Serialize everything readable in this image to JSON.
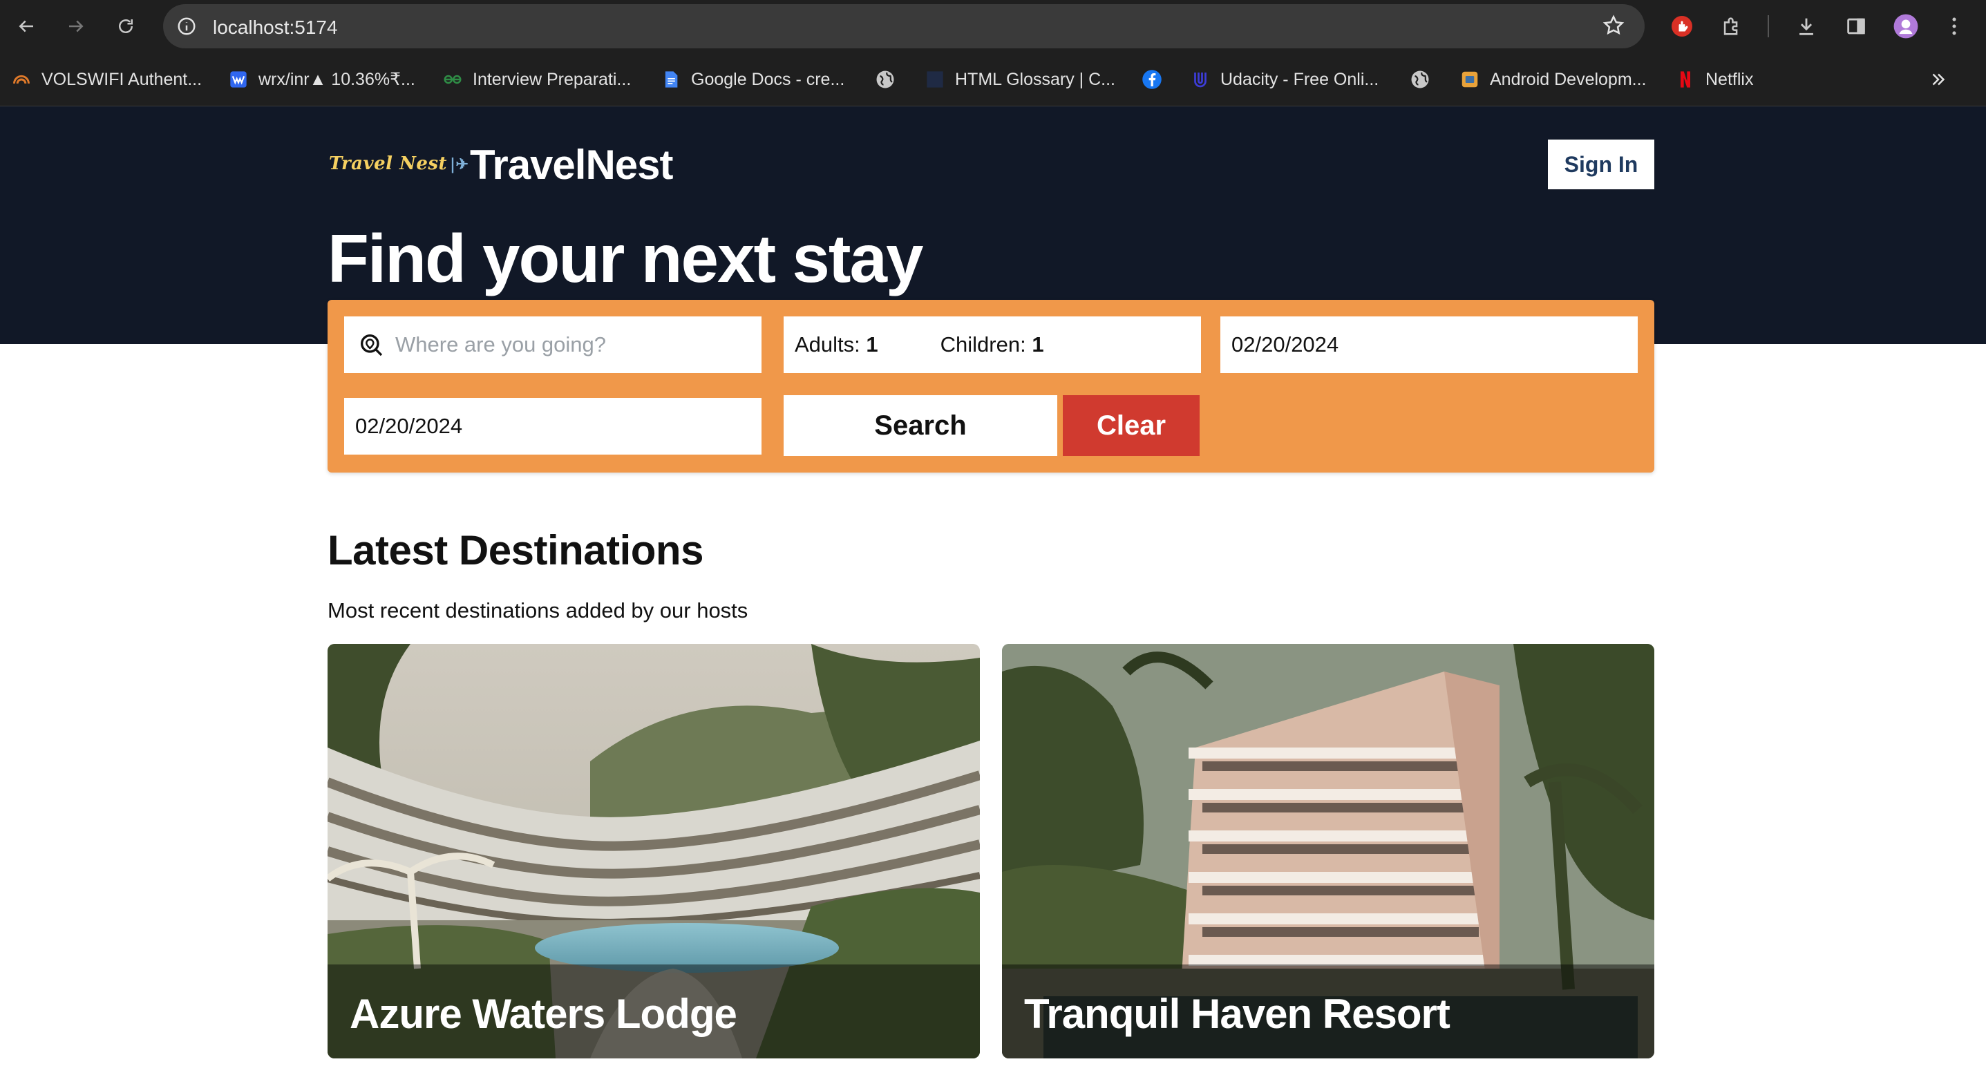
{
  "browser": {
    "url": "localhost:5174",
    "bookmarks": [
      {
        "label": "VOLSWIFI Authent...",
        "icon": "volswifi-icon"
      },
      {
        "label": "wrx/inr▲ 10.36%₹...",
        "icon": "wazirx-icon"
      },
      {
        "label": "Interview Preparati...",
        "icon": "gfg-icon"
      },
      {
        "label": "Google Docs - cre...",
        "icon": "google-docs-icon"
      },
      {
        "label": "",
        "icon": "globe-icon"
      },
      {
        "label": "HTML Glossary | C...",
        "icon": "codecademy-icon"
      },
      {
        "label": "",
        "icon": "facebook-icon"
      },
      {
        "label": "Udacity - Free Onli...",
        "icon": "udacity-icon"
      },
      {
        "label": "",
        "icon": "globe-icon"
      },
      {
        "label": "Android Developm...",
        "icon": "android-icon"
      },
      {
        "label": "Netflix",
        "icon": "netflix-icon"
      }
    ],
    "colors": {
      "frame": "#1f1f1f",
      "omnibox": "#3a3a3a"
    }
  },
  "header": {
    "logo_text": "Travel Nest",
    "brand": "TravelNest",
    "sign_in_label": "Sign In"
  },
  "hero": {
    "title": "Find your next stay"
  },
  "search": {
    "destination_placeholder": "Where are you going?",
    "adults_label": "Adults:",
    "adults_value": "1",
    "children_label": "Children:",
    "children_value": "1",
    "check_in": "02/20/2024",
    "check_out": "02/20/2024",
    "search_label": "Search",
    "clear_label": "Clear"
  },
  "latest": {
    "title": "Latest Destinations",
    "subtitle": "Most recent destinations added by our hosts",
    "cards": [
      {
        "name": "Azure Waters Lodge"
      },
      {
        "name": "Tranquil Haven Resort"
      }
    ]
  },
  "colors": {
    "hero_bg": "#111827",
    "search_panel": "#f0984a",
    "clear_button": "#d03a2f",
    "sign_in_text": "#1f3a5f"
  }
}
